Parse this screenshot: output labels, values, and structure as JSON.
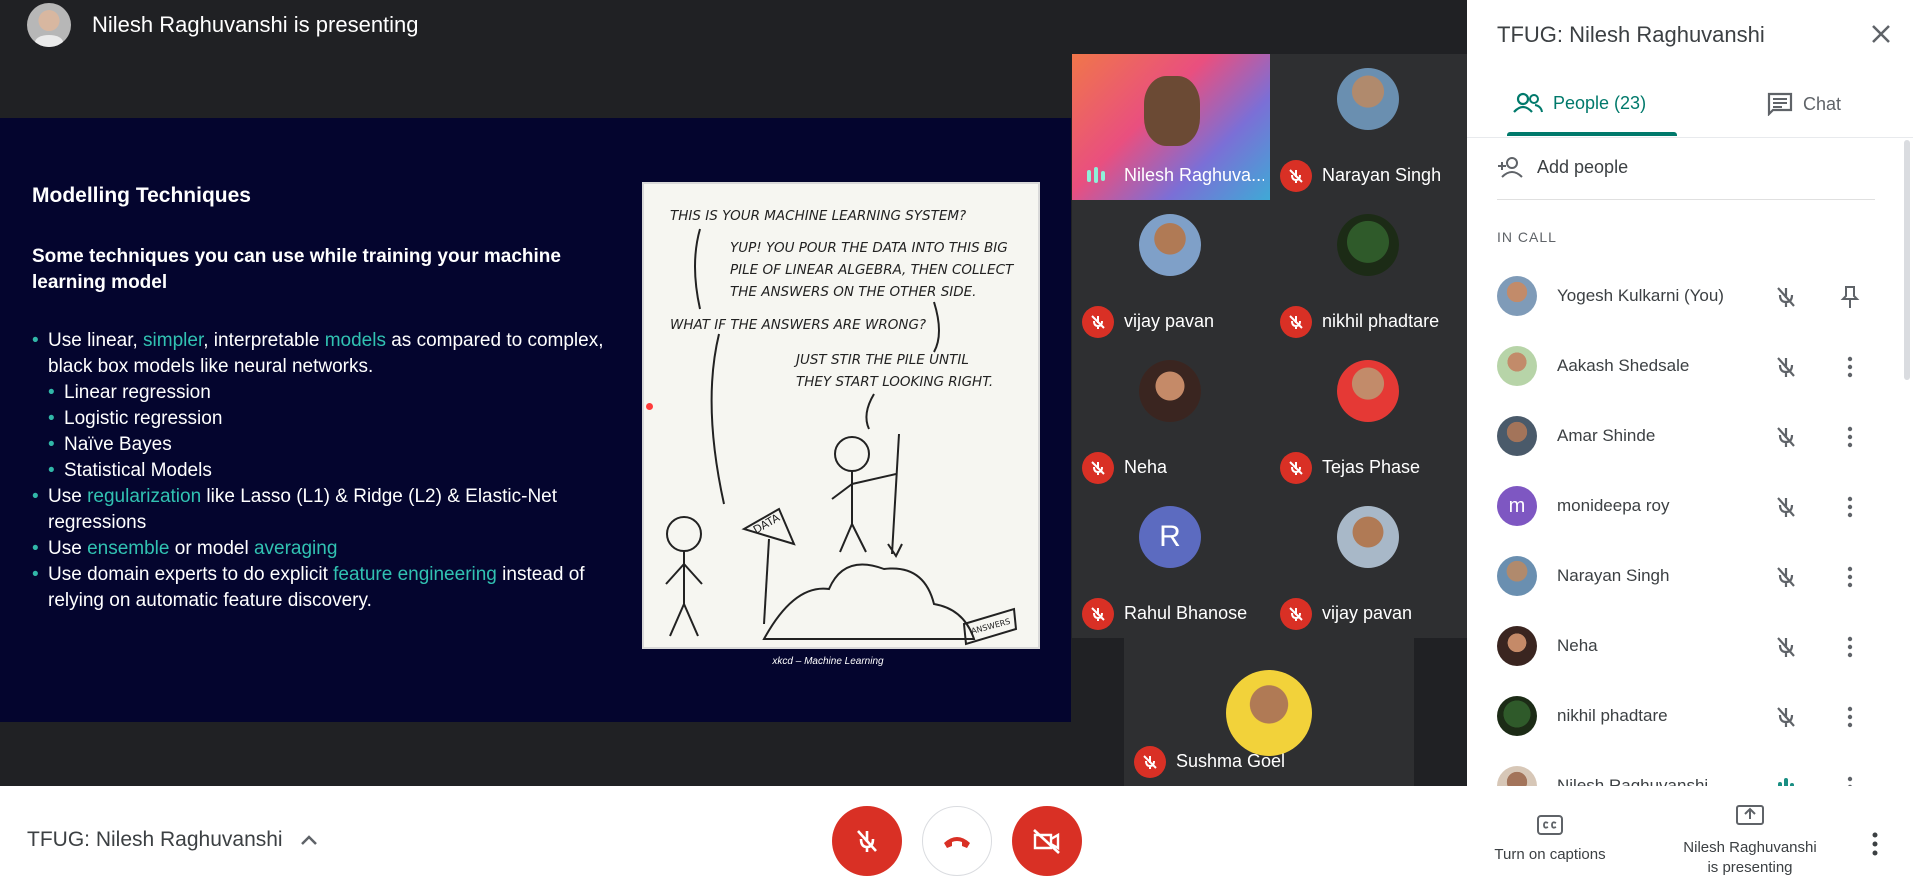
{
  "presenter": {
    "title": "Nilesh Raghuvanshi is presenting"
  },
  "slide": {
    "heading": "Modelling Techniques",
    "subheading": "Some techniques you can use while training your machine learning model",
    "bullets": [
      {
        "parts": [
          "Use linear, ",
          "simpler",
          ", interpretable ",
          "models",
          " as compared to complex, black box models like neural networks."
        ]
      },
      {
        "text": "Linear regression"
      },
      {
        "text": "Logistic regression"
      },
      {
        "text": "Naïve Bayes"
      },
      {
        "text": "Statistical Models"
      },
      {
        "parts": [
          "Use ",
          "regularization",
          " like Lasso (L1) & Ridge (L2) & Elastic-Net regressions"
        ]
      },
      {
        "parts": [
          "Use ",
          "ensemble",
          " or model ",
          "averaging"
        ]
      },
      {
        "parts": [
          "Use domain experts to do explicit ",
          "feature engineering",
          " instead of relying on automatic feature discovery."
        ]
      }
    ],
    "comic": {
      "line1": "THIS IS YOUR MACHINE LEARNING SYSTEM?",
      "line2": "YUP! YOU POUR THE DATA INTO THIS BIG",
      "line3": "PILE OF LINEAR ALGEBRA, THEN COLLECT",
      "line4": "THE ANSWERS ON THE OTHER SIDE.",
      "line5": "WHAT IF THE ANSWERS ARE WRONG?",
      "line6": "JUST STIR THE PILE UNTIL",
      "line7": "THEY START LOOKING RIGHT.",
      "sign": "DATA",
      "box": "ANSWERS"
    },
    "caption": "xkcd – Machine Learning"
  },
  "tiles": [
    {
      "name": "Nilesh Raghuva...",
      "speaking": true
    },
    {
      "name": "Narayan Singh"
    },
    {
      "name": "vijay pavan"
    },
    {
      "name": "nikhil phadtare"
    },
    {
      "name": "Neha"
    },
    {
      "name": "Tejas Phase"
    },
    {
      "name": "Rahul Bhanose",
      "initial": "R"
    },
    {
      "name": "vijay pavan"
    },
    {
      "name": "Sushma Goel"
    }
  ],
  "panel": {
    "title": "TFUG: Nilesh Raghuvanshi",
    "tab_people": "People (23)",
    "tab_chat": "Chat",
    "add_people": "Add people",
    "in_call": "IN CALL",
    "people": [
      {
        "name": "Yogesh Kulkarni (You)"
      },
      {
        "name": "Aakash Shedsale"
      },
      {
        "name": "Amar Shinde"
      },
      {
        "name": "monideepa roy",
        "initial": "m"
      },
      {
        "name": "Narayan Singh"
      },
      {
        "name": "Neha"
      },
      {
        "name": "nikhil phadtare"
      },
      {
        "name": "Nilesh Raghuvanshi"
      }
    ]
  },
  "bottom": {
    "meeting_name": "TFUG: Nilesh Raghuvanshi",
    "captions": "Turn on captions",
    "presenting_line1": "Nilesh Raghuvanshi",
    "presenting_line2": "is presenting"
  },
  "colors": {
    "accent": "#00796b",
    "danger": "#d93025",
    "highlight": "#31c2b2",
    "slide_bg": "#04052e"
  }
}
